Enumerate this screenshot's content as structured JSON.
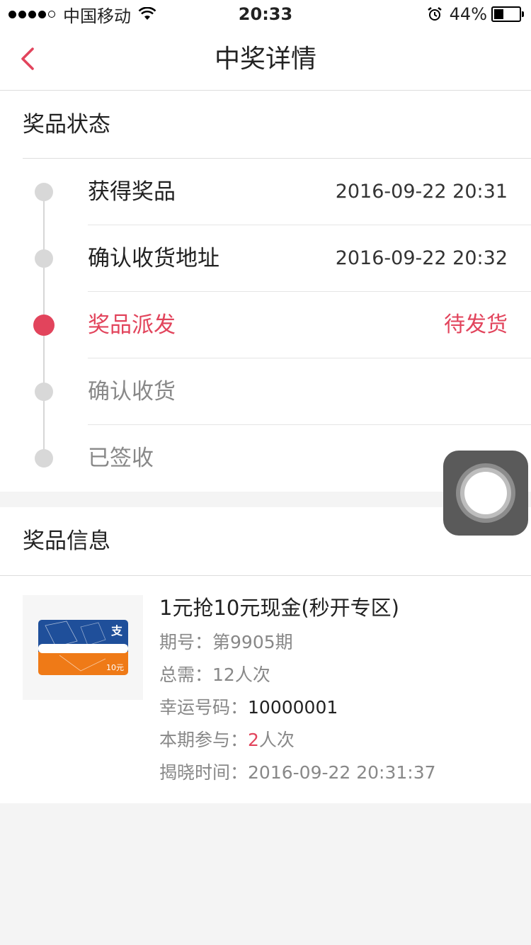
{
  "status_bar": {
    "carrier": "中国移动",
    "time": "20:33",
    "battery": "44%",
    "battery_level": 0.44,
    "signal_icon": "signal-dots-icon",
    "wifi_icon": "wifi-icon",
    "alarm_icon": "alarm-icon"
  },
  "nav": {
    "title": "中奖详情",
    "back_icon": "chevron-left-icon"
  },
  "colors": {
    "accent": "#e2445c",
    "muted_dot": "#d8d8d8",
    "background": "#f4f4f4"
  },
  "prize_status": {
    "header": "奖品状态",
    "steps": [
      {
        "title": "获得奖品",
        "value": "2016-09-22 20:31",
        "state": "done"
      },
      {
        "title": "确认收货地址",
        "value": "2016-09-22 20:32",
        "state": "done"
      },
      {
        "title": "奖品派发",
        "value": "待发货",
        "state": "active"
      },
      {
        "title": "确认收货",
        "value": "",
        "state": "pending"
      },
      {
        "title": "已签收",
        "value": "",
        "state": "pending"
      }
    ]
  },
  "prize_info": {
    "header": "奖品信息",
    "thumbnail_icon": "alipay-card-icon",
    "title": "1元抢10元现金(秒开专区)",
    "period_label": "期号：",
    "period_value": "第9905期",
    "total_label": "总需：",
    "total_value": "12人次",
    "lucky_label": "幸运号码：",
    "lucky_value": "10000001",
    "participate_label": "本期参与：",
    "participate_count": "2",
    "participate_unit": "人次",
    "reveal_label": "揭晓时间：",
    "reveal_value": "2016-09-22 20:31:37"
  },
  "assistive_touch": {
    "icon": "assistive-touch-icon"
  }
}
